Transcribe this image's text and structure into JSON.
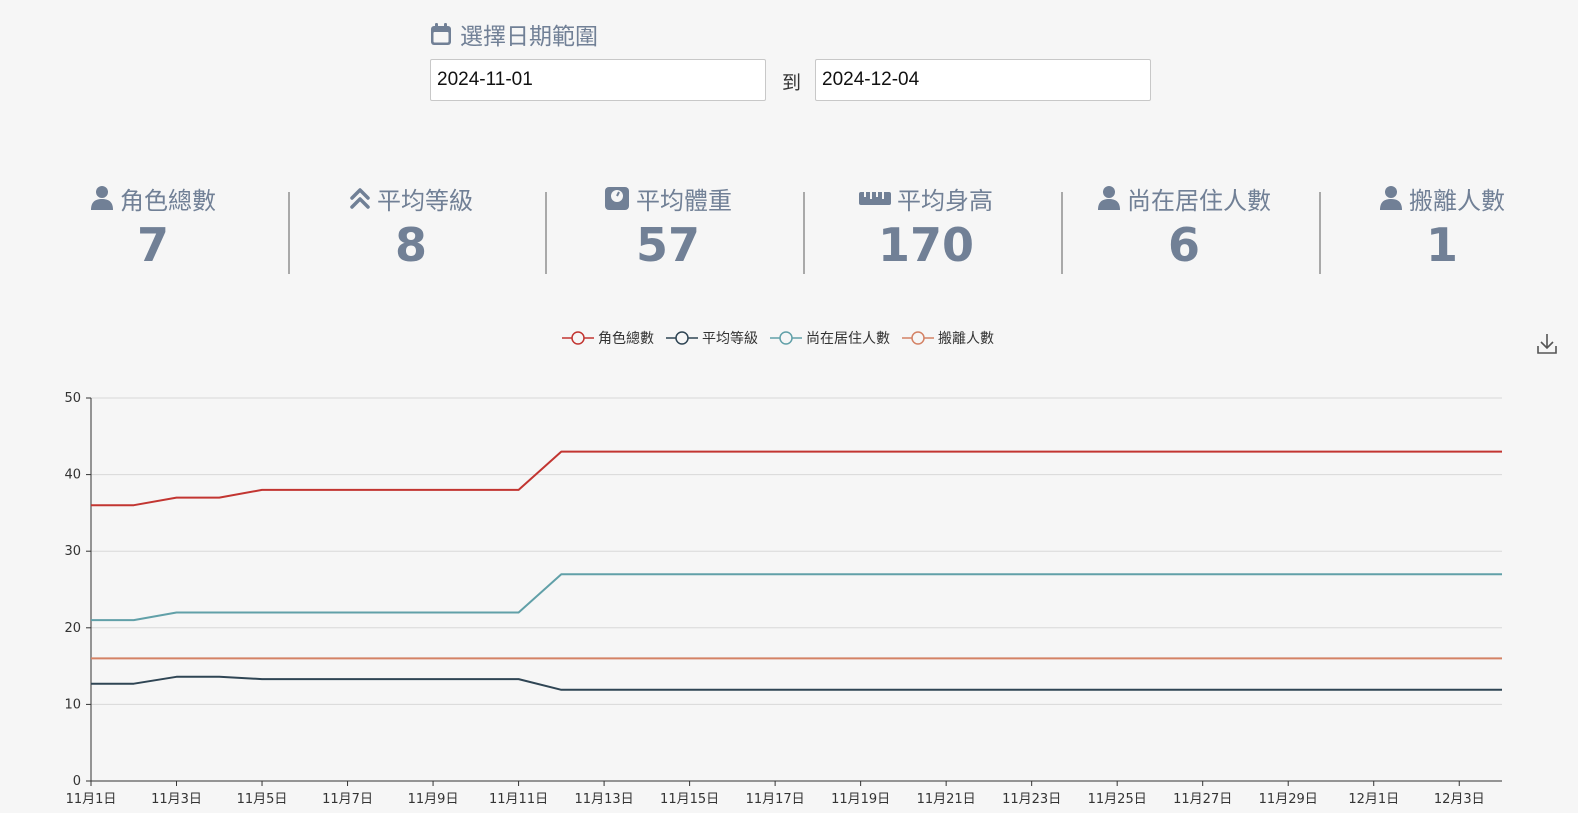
{
  "date_range": {
    "title": "選擇日期範圍",
    "start": "2024-11-01",
    "to_label": "到",
    "end": "2024-12-04"
  },
  "stats": [
    {
      "label": "角色總數",
      "value": "7",
      "icon": "user-icon"
    },
    {
      "label": "平均等級",
      "value": "8",
      "icon": "angles-up-icon"
    },
    {
      "label": "平均體重",
      "value": "57",
      "icon": "weight-scale-icon"
    },
    {
      "label": "平均身高",
      "value": "170",
      "icon": "ruler-icon"
    },
    {
      "label": "尚在居住人數",
      "value": "6",
      "icon": "user-icon"
    },
    {
      "label": "搬離人數",
      "value": "1",
      "icon": "user-icon"
    }
  ],
  "colors": {
    "accent_text": "#718096",
    "series": [
      "#c23531",
      "#2f4554",
      "#61a0a8",
      "#d48265"
    ],
    "grid": "#d8d8d8",
    "axis": "#333333"
  },
  "chart_data": {
    "type": "line",
    "x": [
      "11月1日",
      "11月2日",
      "11月3日",
      "11月4日",
      "11月5日",
      "11月6日",
      "11月7日",
      "11月8日",
      "11月9日",
      "11月10日",
      "11月11日",
      "11月12日",
      "11月13日",
      "11月14日",
      "11月15日",
      "11月16日",
      "11月17日",
      "11月18日",
      "11月19日",
      "11月20日",
      "11月21日",
      "11月22日",
      "11月23日",
      "11月24日",
      "11月25日",
      "11月26日",
      "11月27日",
      "11月28日",
      "11月29日",
      "11月30日",
      "12月1日",
      "12月2日",
      "12月3日",
      "12月4日"
    ],
    "x_tick_labels": [
      "11月1日",
      "11月3日",
      "11月5日",
      "11月7日",
      "11月9日",
      "11月11日",
      "11月13日",
      "11月15日",
      "11月17日",
      "11月19日",
      "11月21日",
      "11月23日",
      "11月25日",
      "11月27日",
      "11月29日",
      "12月1日",
      "12月3日"
    ],
    "series": [
      {
        "name": "角色總數",
        "values": [
          36,
          36,
          37,
          37,
          38,
          38,
          38,
          38,
          38,
          38,
          38,
          43,
          43,
          43,
          43,
          43,
          43,
          43,
          43,
          43,
          43,
          43,
          43,
          43,
          43,
          43,
          43,
          43,
          43,
          43,
          43,
          43,
          43,
          43
        ]
      },
      {
        "name": "平均等級",
        "values": [
          12.7,
          12.7,
          13.6,
          13.6,
          13.3,
          13.3,
          13.3,
          13.3,
          13.3,
          13.3,
          13.3,
          11.9,
          11.9,
          11.9,
          11.9,
          11.9,
          11.9,
          11.9,
          11.9,
          11.9,
          11.9,
          11.9,
          11.9,
          11.9,
          11.9,
          11.9,
          11.9,
          11.9,
          11.9,
          11.9,
          11.9,
          11.9,
          11.9,
          11.9
        ]
      },
      {
        "name": "尚在居住人數",
        "values": [
          21,
          21,
          22,
          22,
          22,
          22,
          22,
          22,
          22,
          22,
          22,
          27,
          27,
          27,
          27,
          27,
          27,
          27,
          27,
          27,
          27,
          27,
          27,
          27,
          27,
          27,
          27,
          27,
          27,
          27,
          27,
          27,
          27,
          27
        ]
      },
      {
        "name": "搬離人數",
        "values": [
          16,
          16,
          16,
          16,
          16,
          16,
          16,
          16,
          16,
          16,
          16,
          16,
          16,
          16,
          16,
          16,
          16,
          16,
          16,
          16,
          16,
          16,
          16,
          16,
          16,
          16,
          16,
          16,
          16,
          16,
          16,
          16,
          16,
          16
        ]
      }
    ],
    "ylim": [
      0,
      50
    ],
    "y_ticks": [
      0,
      10,
      20,
      30,
      40,
      50
    ],
    "grid": true,
    "legend_position": "top-center"
  }
}
